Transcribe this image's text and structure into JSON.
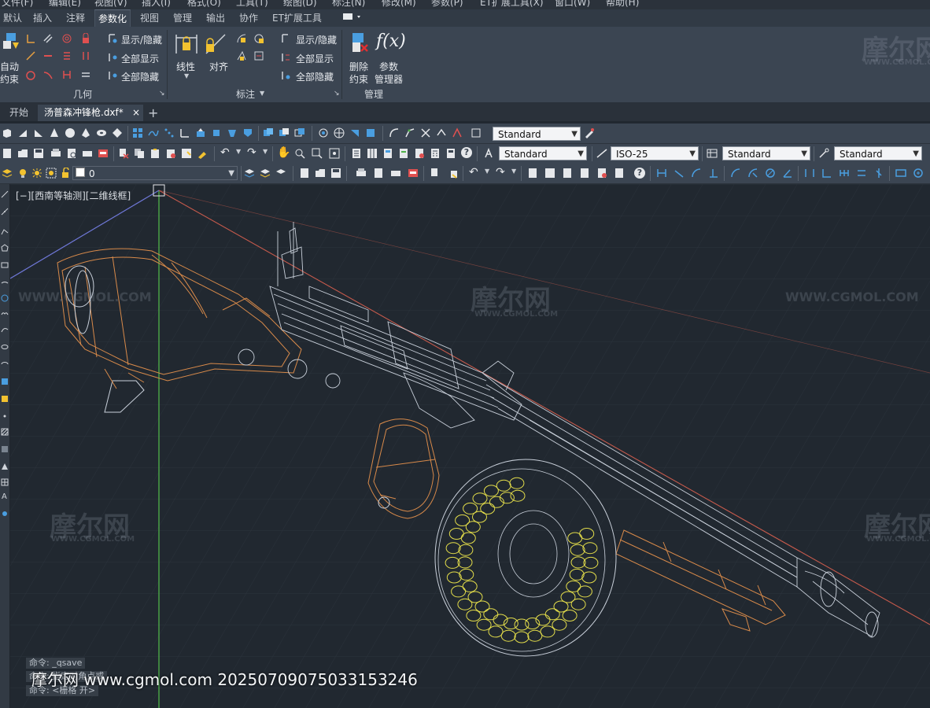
{
  "menu": [
    "文件(F)",
    "编辑(E)",
    "视图(V)",
    "插入(I)",
    "格式(O)",
    "工具(T)",
    "绘图(D)",
    "标注(N)",
    "修改(M)",
    "参数(P)",
    "ET扩展工具(X)",
    "窗口(W)",
    "帮助(H)"
  ],
  "ribbon_tabs": [
    {
      "label": "默认"
    },
    {
      "label": "插入"
    },
    {
      "label": "注释"
    },
    {
      "label": "参数化"
    },
    {
      "label": "视图"
    },
    {
      "label": "管理"
    },
    {
      "label": "输出"
    },
    {
      "label": "协作"
    },
    {
      "label": "ET扩展工具"
    }
  ],
  "active_ribbon_tab": "参数化",
  "ribbon": {
    "geometry": {
      "title": "几何",
      "auto_constrain_1": "自动",
      "auto_constrain_2": "约束",
      "show_hide": "显示/隐藏",
      "show_all": "全部显示",
      "hide_all": "全部隐藏"
    },
    "dimensional": {
      "title": "标注",
      "linear": "线性",
      "aligned": "对齐",
      "show_hide": "显示/隐藏",
      "show_all": "全部显示",
      "hide_all": "全部隐藏"
    },
    "manage": {
      "title": "管理",
      "delete_1": "删除",
      "delete_2": "约束",
      "params_1": "参数",
      "params_2": "管理器",
      "fx": "f(x)"
    }
  },
  "doc_tabs": {
    "start": "开始",
    "file": "汤普森冲锋枪.dxf*",
    "close": "×",
    "new": "+"
  },
  "toolbar1": {
    "visual_style": "Standard"
  },
  "toolbar2": {
    "text_style": "Standard",
    "dim_style": "ISO-25",
    "table_style": "Standard",
    "multileader_style": "Standard"
  },
  "toolbar3": {
    "layer": "0"
  },
  "viewport": {
    "label": "[−][西南等轴测][二维线框]"
  },
  "command_history": [
    "命令: _qsave",
    "命令: 指定对角点或",
    "命令: <栅格 开>"
  ],
  "watermarks": {
    "brand": "摩尔网",
    "url": "WWW.CGMOL.COM",
    "caption": "摩尔网 www.cgmol.com 20250709075033153246"
  },
  "colors": {
    "stock": "#d88a4a",
    "metal": "#c9d0da",
    "drum": "#e2dc4a",
    "ucs_x": "#c65a4c",
    "ucs_y": "#4fb34a",
    "ucs_z": "#6f78d8"
  }
}
